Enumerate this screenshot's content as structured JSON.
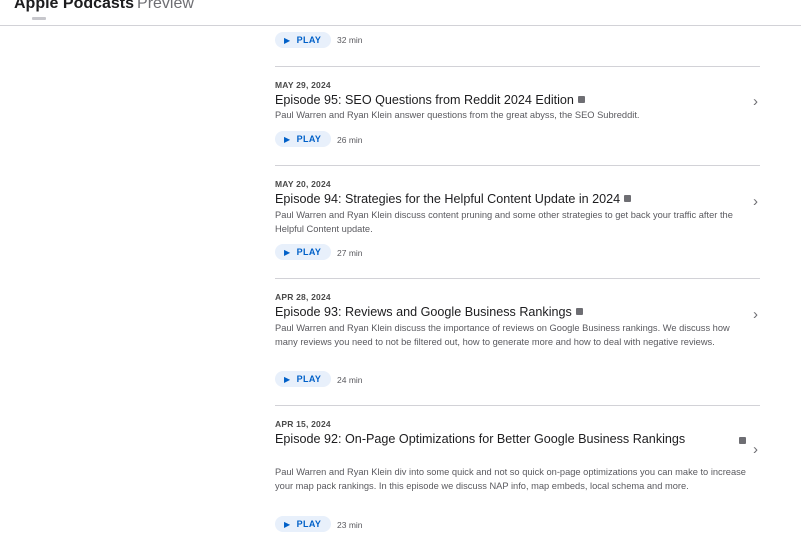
{
  "header": {
    "brand": "Apple Podcasts",
    "suffix": "Preview"
  },
  "top_row": {
    "play_label": "PLAY",
    "duration": "32 min"
  },
  "episodes": [
    {
      "date": "MAY 29, 2024",
      "title": "Episode 95: SEO Questions from Reddit 2024 Edition",
      "description": "Paul Warren and Ryan Klein answer questions from the great abyss, the SEO Subreddit.",
      "play_label": "PLAY",
      "duration": "26 min"
    },
    {
      "date": "MAY 20, 2024",
      "title": "Episode 94: Strategies for the Helpful Content Update in 2024",
      "description": "Paul Warren and Ryan Klein discuss content pruning and some other strategies to get back your traffic after the Helpful Content update.",
      "play_label": "PLAY",
      "duration": "27 min"
    },
    {
      "date": "APR 28, 2024",
      "title": "Episode 93: Reviews and Google Business Rankings",
      "description": "Paul Warren and Ryan Klein discuss the importance of reviews on Google Business rankings. We discuss how many reviews you need to not be filtered out, how to generate more and how to deal with negative reviews.",
      "play_label": "PLAY",
      "duration": "24 min"
    },
    {
      "date": "APR 15, 2024",
      "title": "Episode 92: On-Page Optimizations for Better Google Business Rankings",
      "description": "Paul Warren and Ryan Klein div into some quick and not so quick on-page optimizations you can make to increase your map pack rankings. In this episode we discuss NAP info, map embeds, local schema and more.",
      "play_label": "PLAY",
      "duration": "23 min"
    }
  ],
  "icons": {
    "play": "play-triangle-icon",
    "chevron": "chevron-right-icon",
    "explicit": "explicit-badge-icon"
  },
  "colors": {
    "accent": "#0060c8",
    "play_bg": "#e8f0fb",
    "divider": "#d2d2d7"
  }
}
